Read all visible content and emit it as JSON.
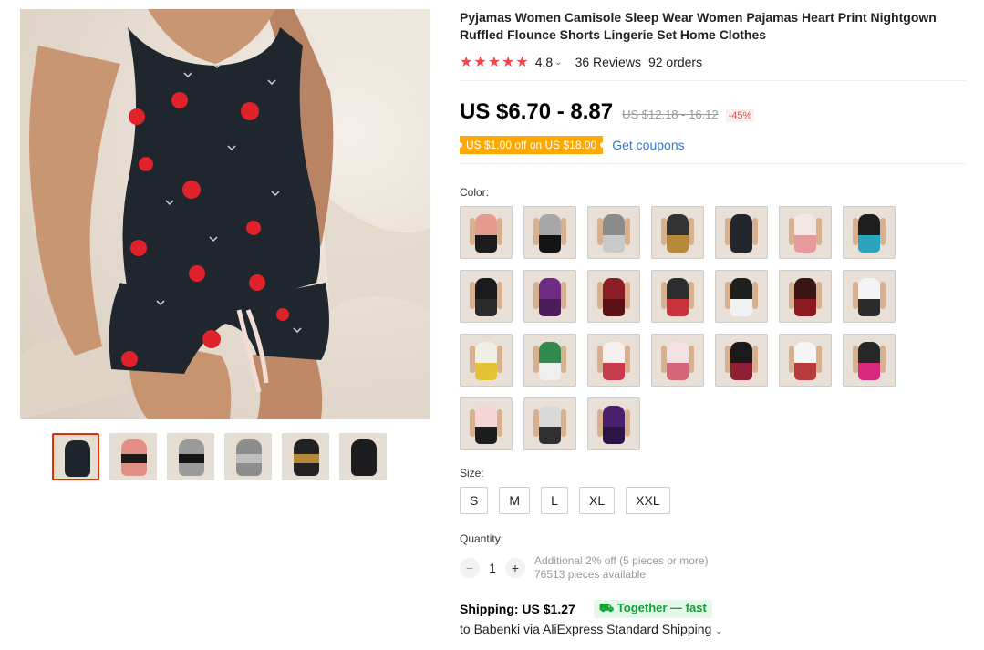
{
  "product": {
    "title": "Pyjamas Women Camisole Sleep Wear Women Pajamas Heart Print Nightgown Ruffled Flounce Shorts Lingerie Set Home Clothes",
    "stars": "★★★★★",
    "rating": "4.8",
    "reviews": "36 Reviews",
    "orders": "92 orders",
    "price": "US $6.70 - 8.87",
    "old_price": "US $12.18 - 16.12",
    "discount": "-45%",
    "coupon": "US $1.00 off on US $18.00",
    "get_coupons": "Get coupons"
  },
  "gallery": {
    "thumbnails": [
      {
        "top": "#1e252c",
        "band": "#1e252c"
      },
      {
        "top": "#e38f86",
        "band": "#1b1b1b"
      },
      {
        "top": "#9a9a9a",
        "band": "#151515"
      },
      {
        "top": "#8d8d8d",
        "band": "#bfbfbf"
      },
      {
        "top": "#222222",
        "band": "#b58a37"
      },
      {
        "top": "#1c1c1c",
        "band": "#1c1c1c"
      }
    ]
  },
  "color": {
    "label": "Color:",
    "swatches": [
      {
        "top": "#e8998f",
        "bottom": "#1b1b1b"
      },
      {
        "top": "#a7a7a7",
        "bottom": "#141414"
      },
      {
        "top": "#8b8b8b",
        "bottom": "#c9c9c9"
      },
      {
        "top": "#333333",
        "bottom": "#b68a3b"
      },
      {
        "top": "#23272d",
        "bottom": "#23272d"
      },
      {
        "top": "#f1e7e4",
        "bottom": "#e59a9c"
      },
      {
        "top": "#1e1e1e",
        "bottom": "#2aa3bd"
      },
      {
        "top": "#1a1a1a",
        "bottom": "#2b2b2b"
      },
      {
        "top": "#6f2a83",
        "bottom": "#4b1d59"
      },
      {
        "top": "#8b1e24",
        "bottom": "#5a1015"
      },
      {
        "top": "#2d2d2d",
        "bottom": "#c8323a"
      },
      {
        "top": "#1f1f1f",
        "bottom": "#f2f2f2"
      },
      {
        "top": "#3a1515",
        "bottom": "#8b1b1f"
      },
      {
        "top": "#f4f4f4",
        "bottom": "#2b2b2b"
      },
      {
        "top": "#f0efe5",
        "bottom": "#e4c233"
      },
      {
        "top": "#2f8a4c",
        "bottom": "#efefef"
      },
      {
        "top": "#f6f0ee",
        "bottom": "#c73b4c"
      },
      {
        "top": "#f3e2e1",
        "bottom": "#d76579"
      },
      {
        "top": "#1a1a1a",
        "bottom": "#8e1f34"
      },
      {
        "top": "#f5f5f5",
        "bottom": "#b93a3a"
      },
      {
        "top": "#272727",
        "bottom": "#d8287d"
      },
      {
        "top": "#f6d4d7",
        "bottom": "#1d1d1d"
      },
      {
        "top": "#d9d9d9",
        "bottom": "#303030"
      },
      {
        "top": "#4a1f6f",
        "bottom": "#2d1447"
      }
    ]
  },
  "size": {
    "label": "Size:",
    "options": [
      "S",
      "M",
      "L",
      "XL",
      "XXL"
    ]
  },
  "quantity": {
    "label": "Quantity:",
    "minus": "−",
    "value": "1",
    "plus": "+",
    "additional": "Additional 2% off (5 pieces or more)",
    "available": "76513 pieces available"
  },
  "shipping": {
    "label": "Shipping: US $1.27",
    "together": "Together — fast",
    "destination": "to Babenki via AliExpress Standard Shipping"
  },
  "colors": {
    "accent": "#e62e04",
    "price_red": "#f2474a",
    "coupon_orange": "#ffa800",
    "link_blue": "#2e7bd5",
    "green": "#15a038"
  }
}
